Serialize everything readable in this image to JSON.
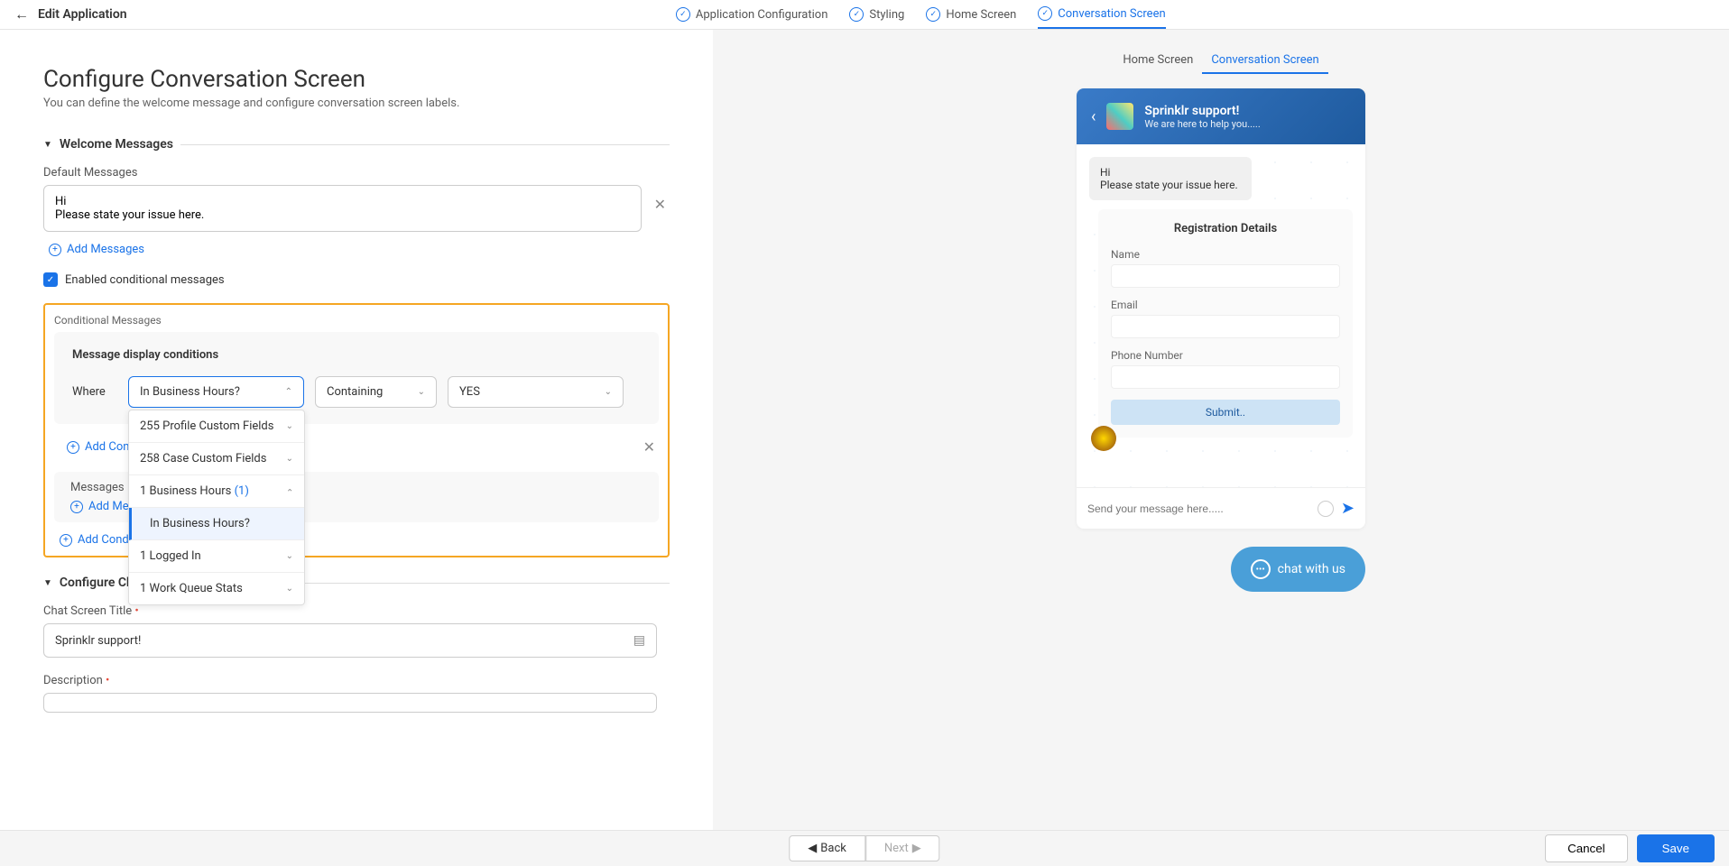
{
  "header": {
    "title": "Edit Application",
    "tabs": {
      "config": "Application Configuration",
      "styling": "Styling",
      "home": "Home Screen",
      "conversation": "Conversation Screen"
    }
  },
  "page": {
    "title": "Configure Conversation Screen",
    "subtitle": "You can define the welcome message and configure conversation screen labels."
  },
  "sections": {
    "welcome": "Welcome Messages",
    "chat_screen": "Configure Chat Screen"
  },
  "welcome": {
    "default_label": "Default Messages",
    "default_value": "Hi\nPlease state your issue here.",
    "add_messages": "Add Messages",
    "enable_conditional": "Enabled conditional messages"
  },
  "conditional": {
    "label": "Conditional Messages",
    "title": "Message display conditions",
    "where": "Where",
    "field1": "In Business Hours?",
    "field2": "Containing",
    "field3": "YES",
    "add_condition": "Add Condi",
    "messages_label": "Messages",
    "add_message": "Add Messa",
    "add_conditional": "Add Condition",
    "dropdown": {
      "opt1": "255 Profile Custom Fields",
      "opt2": "258 Case Custom Fields",
      "opt3_prefix": "1 Business Hours",
      "opt3_count": "(1)",
      "opt3a": "In Business Hours?",
      "opt4": "1 Logged In",
      "opt5": "1 Work Queue Stats"
    }
  },
  "chat_config": {
    "title_label": "Chat Screen Title",
    "title_value": "Sprinklr support!",
    "desc_label": "Description"
  },
  "preview": {
    "tab_home": "Home Screen",
    "tab_conv": "Conversation Screen",
    "chat_title": "Sprinklr support!",
    "chat_sub": "We are here to help you.....",
    "bubble_hi": "Hi",
    "bubble_msg": "Please state your issue here.",
    "reg_title": "Registration Details",
    "reg_name": "Name",
    "reg_email": "Email",
    "reg_phone": "Phone Number",
    "submit": "Submit..",
    "input_placeholder": "Send your message here.....",
    "fab": "chat with us"
  },
  "footer": {
    "back": "Back",
    "next": "Next",
    "cancel": "Cancel",
    "save": "Save"
  }
}
